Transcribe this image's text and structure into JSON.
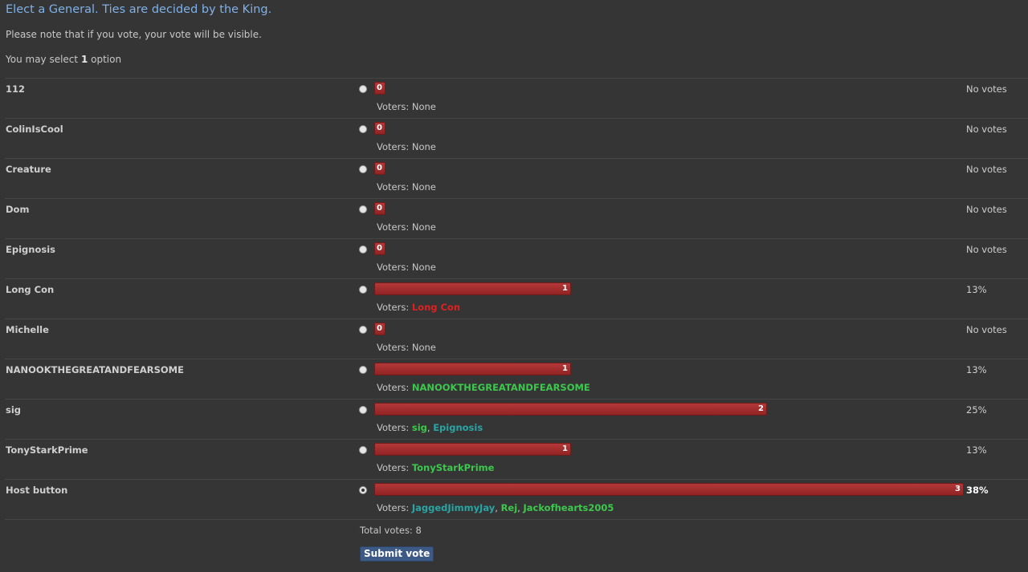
{
  "poll": {
    "title": "Elect a General. Ties are decided by the King.",
    "note": "Please note that if you vote, your vote will be visible.",
    "select_prefix": "You may select ",
    "select_count": "1",
    "select_suffix": " option",
    "voters_prefix": "Voters: ",
    "total_votes": "Total votes: 8",
    "submit_label": "Submit vote",
    "max_votes": 3,
    "colors": {
      "bar": "#a22c2c",
      "voter_red": "#e02020",
      "voter_green": "#3cc84c",
      "voter_teal": "#2aa4a4",
      "title": "#7fb1e8"
    },
    "options": [
      {
        "label": "112",
        "votes": 0,
        "count": "0",
        "percent": "No votes",
        "voters": [
          {
            "name": "None",
            "color": ""
          }
        ],
        "checked": false
      },
      {
        "label": "ColinIsCool",
        "votes": 0,
        "count": "0",
        "percent": "No votes",
        "voters": [
          {
            "name": "None",
            "color": ""
          }
        ],
        "checked": false
      },
      {
        "label": "Creature",
        "votes": 0,
        "count": "0",
        "percent": "No votes",
        "voters": [
          {
            "name": "None",
            "color": ""
          }
        ],
        "checked": false
      },
      {
        "label": "Dom",
        "votes": 0,
        "count": "0",
        "percent": "No votes",
        "voters": [
          {
            "name": "None",
            "color": ""
          }
        ],
        "checked": false
      },
      {
        "label": "Epignosis",
        "votes": 0,
        "count": "0",
        "percent": "No votes",
        "voters": [
          {
            "name": "None",
            "color": ""
          }
        ],
        "checked": false
      },
      {
        "label": "Long Con",
        "votes": 1,
        "count": "1",
        "percent": "13%",
        "voters": [
          {
            "name": "Long Con",
            "color": "#e02020"
          }
        ],
        "checked": false
      },
      {
        "label": "Michelle",
        "votes": 0,
        "count": "0",
        "percent": "No votes",
        "voters": [
          {
            "name": "None",
            "color": ""
          }
        ],
        "checked": false
      },
      {
        "label": "NANOOKTHEGREATANDFEARSOME",
        "votes": 1,
        "count": "1",
        "percent": "13%",
        "voters": [
          {
            "name": "NANOOKTHEGREATANDFEARSOME",
            "color": "#3cc84c"
          }
        ],
        "checked": false
      },
      {
        "label": "sig",
        "votes": 2,
        "count": "2",
        "percent": "25%",
        "voters": [
          {
            "name": "sig",
            "color": "#3cc84c"
          },
          {
            "name": "Epignosis",
            "color": "#2aa4a4"
          }
        ],
        "checked": false
      },
      {
        "label": "TonyStarkPrime",
        "votes": 1,
        "count": "1",
        "percent": "13%",
        "voters": [
          {
            "name": "TonyStarkPrime",
            "color": "#3cc84c"
          }
        ],
        "checked": false
      },
      {
        "label": "Host button",
        "votes": 3,
        "count": "3",
        "percent": "38%",
        "voters": [
          {
            "name": "JaggedJimmyJay",
            "color": "#2aa4a4"
          },
          {
            "name": "Rej",
            "color": "#3cc84c"
          },
          {
            "name": "Jackofhearts2005",
            "color": "#3cc84c"
          }
        ],
        "checked": true
      }
    ]
  }
}
